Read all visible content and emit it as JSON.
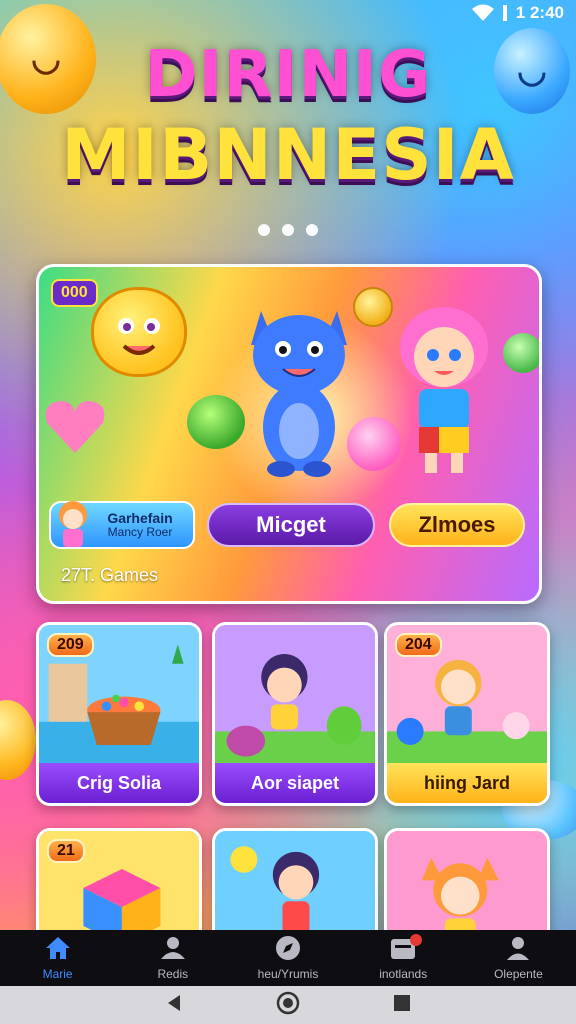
{
  "status_bar": {
    "time": "1 2:40"
  },
  "title": {
    "line1": "DIRINIG",
    "line2": "MIBNNESIA"
  },
  "hero": {
    "badge": "000",
    "chip_title": "Garhefain",
    "chip_sub": "Mancy Roer",
    "button_primary": "Micget",
    "button_secondary": "Zlmoes",
    "count": "27T. Games"
  },
  "tiles": [
    {
      "badge": "209",
      "label": "Crig Solia"
    },
    {
      "badge": "",
      "label": "Aor siapet"
    },
    {
      "badge": "204",
      "label": "hiing Jard"
    },
    {
      "badge": "21",
      "label": ""
    },
    {
      "badge": "",
      "label": ""
    },
    {
      "badge": "",
      "label": ""
    }
  ],
  "nav": {
    "items": [
      {
        "label": "Marie",
        "icon": "home-icon"
      },
      {
        "label": "Redis",
        "icon": "people-icon"
      },
      {
        "label": "heu/Yrumis",
        "icon": "compass-icon"
      },
      {
        "label": "inotlands",
        "icon": "inbox-icon"
      },
      {
        "label": "Olepente",
        "icon": "profile-icon"
      }
    ]
  },
  "colors": {
    "accent": "#3f8cff",
    "purple": "#6a1fd1",
    "yellow": "#ffb319"
  }
}
